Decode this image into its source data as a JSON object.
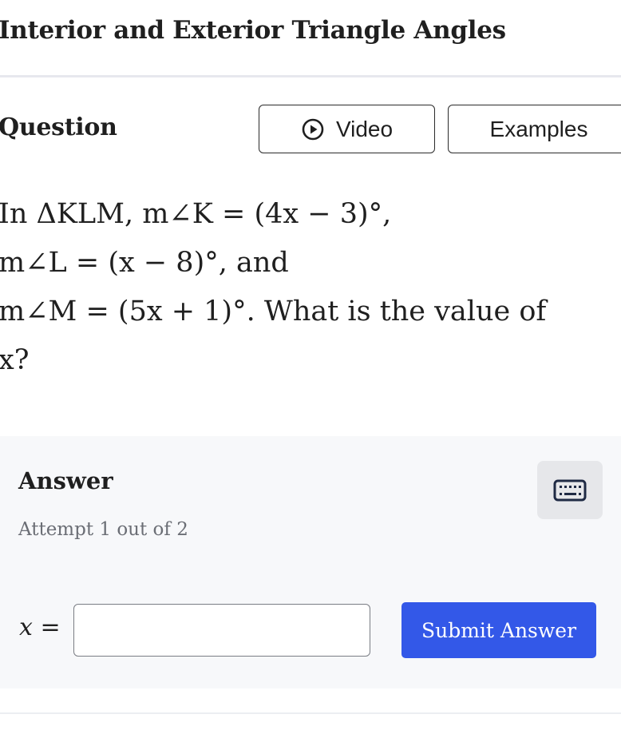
{
  "page": {
    "title": "Interior and Exterior Triangle Angles"
  },
  "question": {
    "heading": "Question",
    "video_button": {
      "label": "Video",
      "icon": "play-circle-icon"
    },
    "examples_button": {
      "label": "Examples"
    },
    "lines": [
      "In ΔKLM, m∠K = (4x − 3)°,",
      "m∠L = (x − 8)°, and",
      "m∠M = (5x + 1)°. What is the value of",
      "x?"
    ]
  },
  "answer": {
    "heading": "Answer",
    "attempt": "Attempt 1 out of 2",
    "keyboard_icon": "keyboard-icon",
    "variable_label": "x =",
    "input_value": "",
    "submit_label": "Submit Answer"
  },
  "colors": {
    "submit_button": "#3358e8",
    "answer_panel": "#f7f8fa",
    "keyboard_button": "#e6e7ea"
  }
}
